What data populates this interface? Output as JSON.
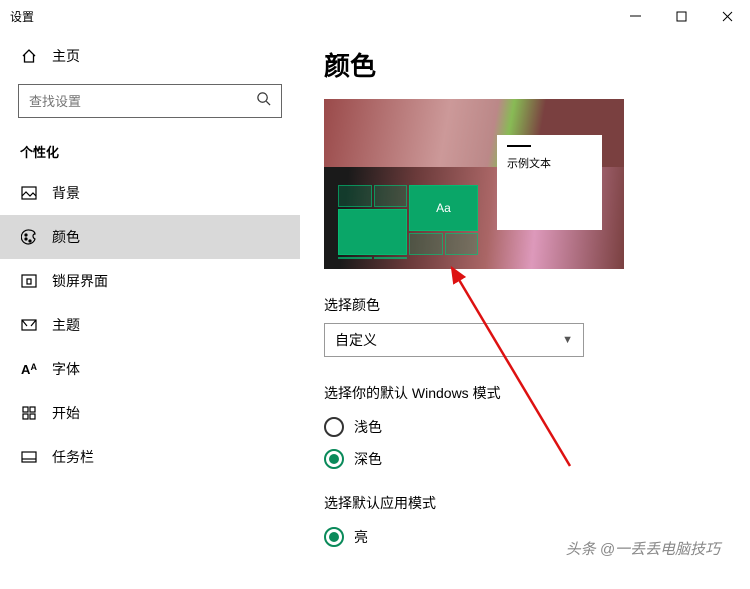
{
  "window": {
    "title": "设置"
  },
  "sidebar": {
    "home": "主页",
    "search_placeholder": "查找设置",
    "group": "个性化",
    "items": [
      {
        "label": "背景"
      },
      {
        "label": "颜色"
      },
      {
        "label": "锁屏界面"
      },
      {
        "label": "主题"
      },
      {
        "label": "字体"
      },
      {
        "label": "开始"
      },
      {
        "label": "任务栏"
      }
    ]
  },
  "page": {
    "title": "颜色",
    "sample_text": "示例文本",
    "tile_text": "Aa",
    "choose_color_label": "选择颜色",
    "choose_color_value": "自定义",
    "win_mode_label": "选择你的默认 Windows 模式",
    "win_mode_options": [
      {
        "label": "浅色",
        "selected": false
      },
      {
        "label": "深色",
        "selected": true
      }
    ],
    "app_mode_label": "选择默认应用模式",
    "app_mode_options": [
      {
        "label": "亮",
        "selected": true
      }
    ]
  },
  "watermark": "头条 @一丢丢电脑技巧"
}
